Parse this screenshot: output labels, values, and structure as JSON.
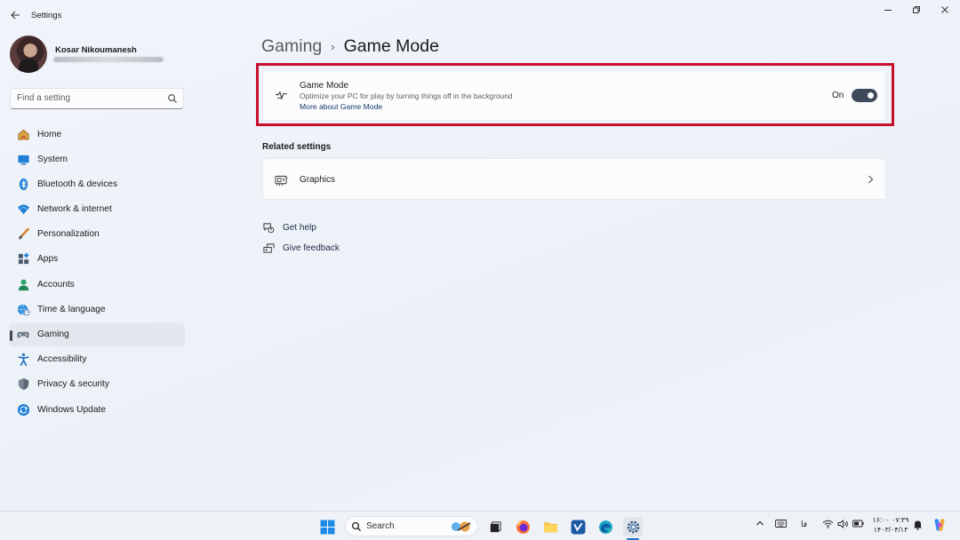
{
  "window": {
    "title": "Settings"
  },
  "profile": {
    "name": "Kosar Nikoumanesh"
  },
  "search": {
    "placeholder": "Find a setting"
  },
  "sidebar": {
    "items": [
      {
        "label": "Home",
        "icon": "home-icon"
      },
      {
        "label": "System",
        "icon": "system-icon"
      },
      {
        "label": "Bluetooth & devices",
        "icon": "bluetooth-icon"
      },
      {
        "label": "Network & internet",
        "icon": "wifi-icon"
      },
      {
        "label": "Personalization",
        "icon": "brush-icon"
      },
      {
        "label": "Apps",
        "icon": "apps-icon"
      },
      {
        "label": "Accounts",
        "icon": "person-icon"
      },
      {
        "label": "Time & language",
        "icon": "globe-clock-icon"
      },
      {
        "label": "Gaming",
        "icon": "gamepad-icon",
        "active": true
      },
      {
        "label": "Accessibility",
        "icon": "accessibility-icon"
      },
      {
        "label": "Privacy & security",
        "icon": "shield-icon"
      },
      {
        "label": "Windows Update",
        "icon": "update-icon"
      }
    ]
  },
  "breadcrumb": {
    "parent": "Gaming",
    "separator": "›",
    "current": "Game Mode"
  },
  "game_mode": {
    "title": "Game Mode",
    "description": "Optimize your PC for play by turning things off in the background",
    "link": "More about Game Mode",
    "toggle_state": "On",
    "enabled": true
  },
  "related": {
    "heading": "Related settings",
    "items": [
      {
        "label": "Graphics",
        "icon": "graphics-card-icon"
      }
    ]
  },
  "help": {
    "get_help": "Get help",
    "give_feedback": "Give feedback"
  },
  "taskbar": {
    "search_label": "Search",
    "language": "فا",
    "clock_time": "۱۶:۰۰ ۰۷:۳۹",
    "clock_date": "۱۴۰۳/۰۴/۱۳"
  },
  "colors": {
    "accent": "#3e4a59",
    "highlight_border": "#c8102e",
    "background": "#eef2f8"
  }
}
